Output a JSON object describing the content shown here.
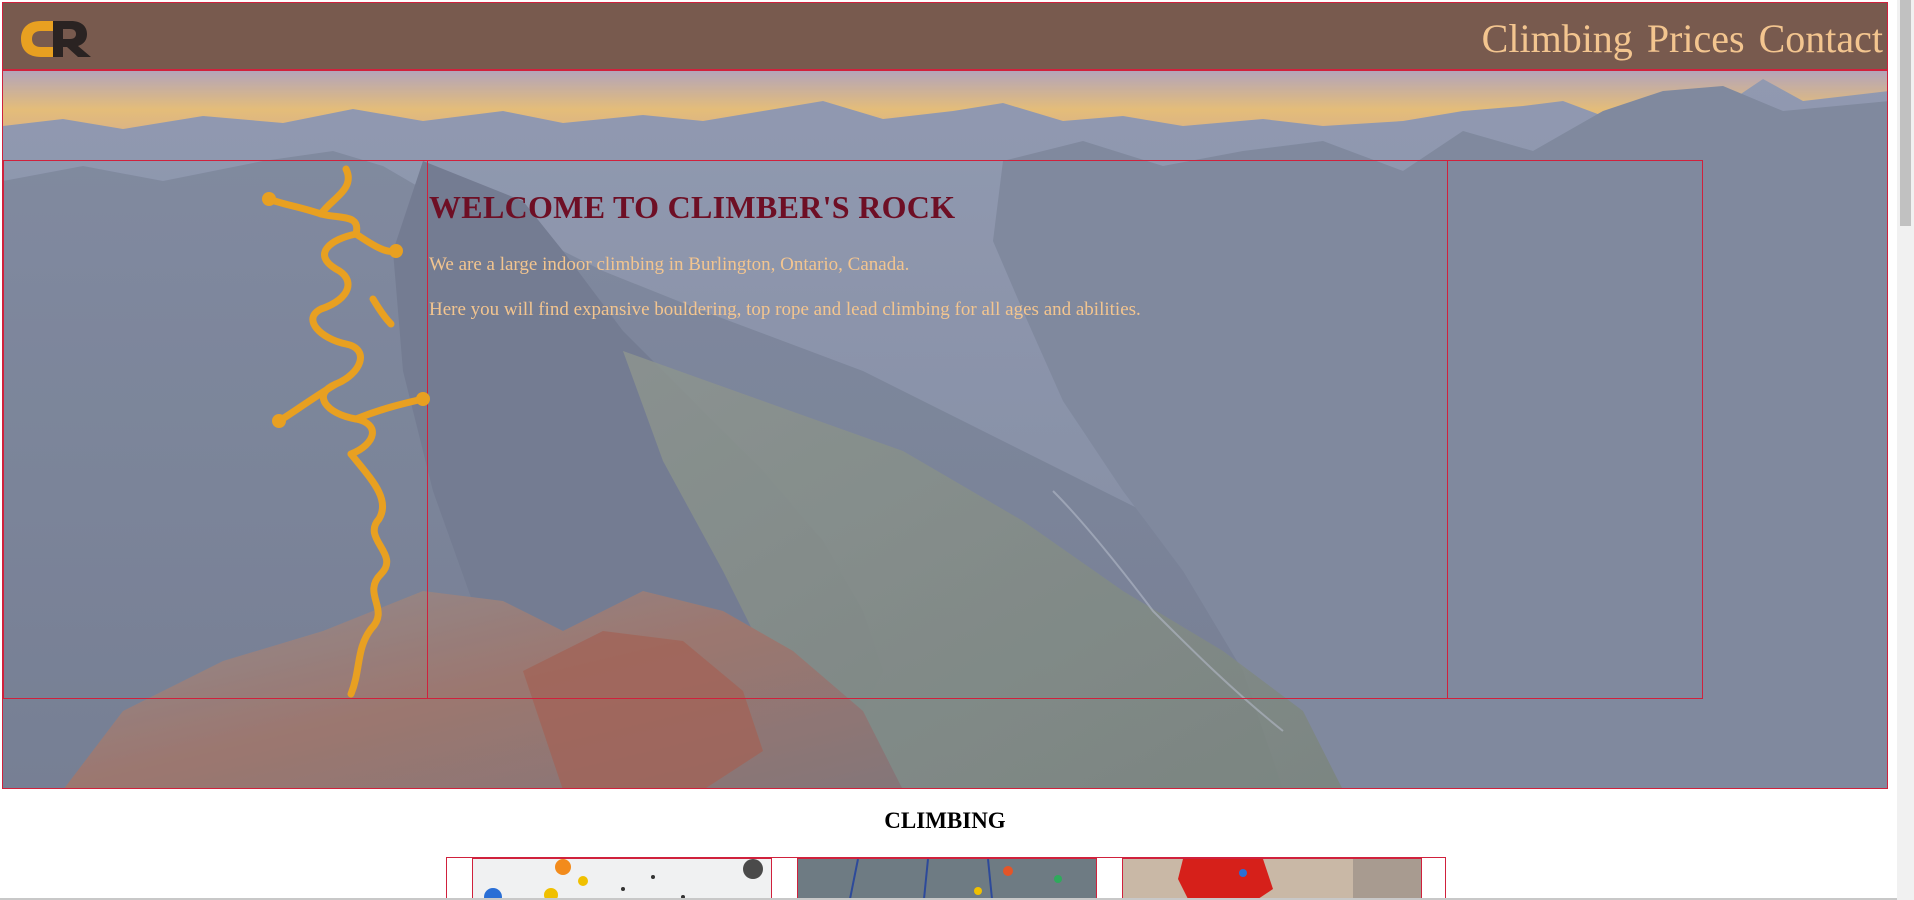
{
  "header": {
    "logo_text": "CR",
    "nav": [
      "Climbing",
      "Prices",
      "Contact"
    ]
  },
  "hero": {
    "title": "WELCOME TO CLIMBER'S ROCK",
    "paragraphs": [
      "We are a large indoor climbing in Burlington, Ontario, Canada.",
      "Here you will find expansive bouldering, top rope and lead climbing for all ages and abilities."
    ]
  },
  "climbing": {
    "title": "CLIMBING"
  },
  "colors": {
    "header_bg": "#785a4e",
    "nav_text": "#f3c58f",
    "title_text": "#6e0f25",
    "accent_orange": "#e8a021",
    "outline_red": "#d0213c"
  }
}
